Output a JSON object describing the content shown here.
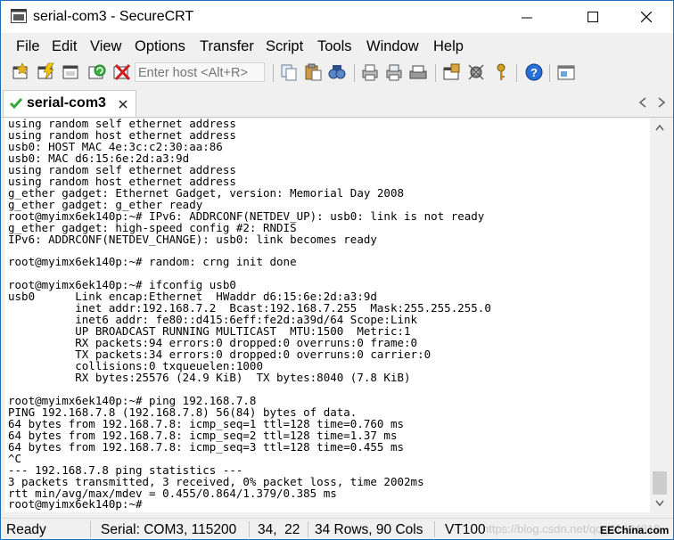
{
  "window": {
    "title": "serial-com3 - SecureCRT"
  },
  "menu": [
    "File",
    "Edit",
    "View",
    "Options",
    "Transfer",
    "Script",
    "Tools",
    "Window",
    "Help"
  ],
  "toolbar": {
    "host_placeholder": "Enter host <Alt+R>"
  },
  "tab": {
    "label": "serial-com3"
  },
  "terminal": {
    "lines": [
      "using random self ethernet address",
      "using random host ethernet address",
      "usb0: HOST MAC 4e:3c:c2:30:aa:86",
      "usb0: MAC d6:15:6e:2d:a3:9d",
      "using random self ethernet address",
      "using random host ethernet address",
      "g_ether gadget: Ethernet Gadget, version: Memorial Day 2008",
      "g_ether gadget: g_ether ready",
      "root@myimx6ek140p:~# IPv6: ADDRCONF(NETDEV_UP): usb0: link is not ready",
      "g_ether gadget: high-speed config #2: RNDIS",
      "IPv6: ADDRCONF(NETDEV_CHANGE): usb0: link becomes ready",
      "",
      "root@myimx6ek140p:~# random: crng init done",
      "",
      "root@myimx6ek140p:~# ifconfig usb0",
      "usb0      Link encap:Ethernet  HWaddr d6:15:6e:2d:a3:9d",
      "          inet addr:192.168.7.2  Bcast:192.168.7.255  Mask:255.255.255.0",
      "          inet6 addr: fe80::d415:6eff:fe2d:a39d/64 Scope:Link",
      "          UP BROADCAST RUNNING MULTICAST  MTU:1500  Metric:1",
      "          RX packets:94 errors:0 dropped:0 overruns:0 frame:0",
      "          TX packets:34 errors:0 dropped:0 overruns:0 carrier:0",
      "          collisions:0 txqueuelen:1000",
      "          RX bytes:25576 (24.9 KiB)  TX bytes:8040 (7.8 KiB)",
      "",
      "root@myimx6ek140p:~# ping 192.168.7.8",
      "PING 192.168.7.8 (192.168.7.8) 56(84) bytes of data.",
      "64 bytes from 192.168.7.8: icmp_seq=1 ttl=128 time=0.760 ms",
      "64 bytes from 192.168.7.8: icmp_seq=2 ttl=128 time=1.37 ms",
      "64 bytes from 192.168.7.8: icmp_seq=3 ttl=128 time=0.455 ms",
      "^C",
      "--- 192.168.7.8 ping statistics ---",
      "3 packets transmitted, 3 received, 0% packet loss, time 2002ms",
      "rtt min/avg/max/mdev = 0.455/0.864/1.379/0.385 ms",
      "root@myimx6ek140p:~#"
    ]
  },
  "status": {
    "ready": "Ready",
    "serial": "Serial: COM3, 115200",
    "cursor": "34,  22",
    "size": "34 Rows, 90 Cols",
    "emulation": "VT100",
    "watermark": "https://blog.csdn.net/qq_41904818",
    "logo": "EEChina.com"
  },
  "colors": {
    "tab_check": "#35a835",
    "help_icon": "#2a6fd6",
    "window_border": "#1e6fb8"
  }
}
